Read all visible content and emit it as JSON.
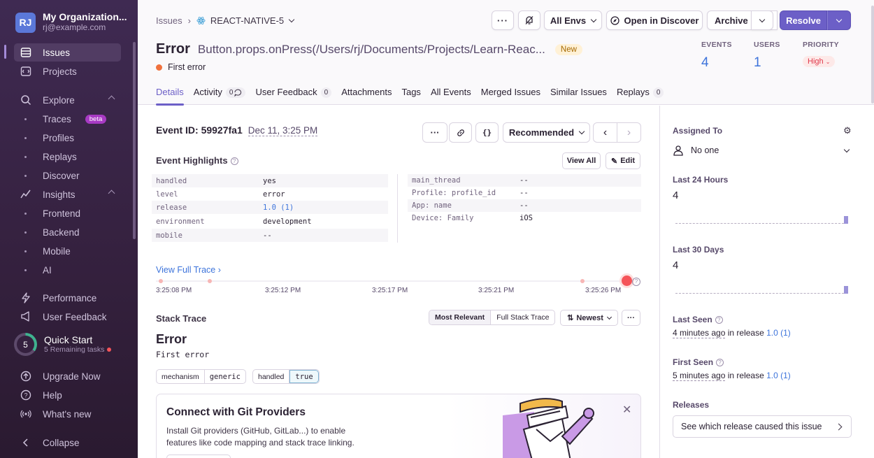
{
  "sidebar": {
    "org_initials": "RJ",
    "org_name": "My Organization...",
    "org_email": "rj@example.com",
    "items": {
      "issues": "Issues",
      "projects": "Projects",
      "explore": "Explore",
      "traces": "Traces",
      "traces_badge": "beta",
      "profiles": "Profiles",
      "replays": "Replays",
      "discover": "Discover",
      "insights": "Insights",
      "frontend": "Frontend",
      "backend": "Backend",
      "mobile": "Mobile",
      "ai": "AI",
      "performance": "Performance",
      "user_feedback": "User Feedback",
      "upgrade": "Upgrade Now",
      "help": "Help",
      "whats_new": "What's new",
      "collapse": "Collapse"
    },
    "quick_start": {
      "count": "5",
      "title": "Quick Start",
      "subtitle": "5 Remaining tasks"
    }
  },
  "header": {
    "breadcrumb_root": "Issues",
    "breadcrumb_project": "REACT-NATIVE-5",
    "env_label": "All Envs",
    "open_discover": "Open in Discover",
    "archive": "Archive",
    "resolve": "Resolve",
    "title": "Error",
    "subtitle": "Button.props.onPress(/Users/rj/Documents/Projects/Learn-Reac...",
    "badge": "New",
    "first_error": "First error",
    "stats": {
      "events_label": "EVENTS",
      "events": "4",
      "users_label": "USERS",
      "users": "1",
      "priority_label": "PRIORITY",
      "priority": "High"
    },
    "tabs": [
      {
        "label": "Details"
      },
      {
        "label": "Activity",
        "count": "0"
      },
      {
        "label": "User Feedback",
        "count": "0"
      },
      {
        "label": "Attachments"
      },
      {
        "label": "Tags"
      },
      {
        "label": "All Events"
      },
      {
        "label": "Merged Issues"
      },
      {
        "label": "Similar Issues"
      },
      {
        "label": "Replays",
        "count": "0"
      }
    ]
  },
  "event": {
    "id_label": "Event ID:",
    "id": "59927fa1",
    "date": "Dec 11, 3:25 PM",
    "sort": "Recommended",
    "json_icon": "{}",
    "highlights_title": "Event Highlights",
    "view_all": "View All",
    "edit": "Edit",
    "highlights_left": [
      {
        "k": "handled",
        "v": "yes"
      },
      {
        "k": "level",
        "v": "error"
      },
      {
        "k": "release",
        "v": "1.0 (1)"
      },
      {
        "k": "environment",
        "v": "development"
      },
      {
        "k": "mobile",
        "v": "--"
      }
    ],
    "highlights_right": [
      {
        "k": "main_thread",
        "v": "--"
      },
      {
        "k": "Profile: profile_id",
        "v": "--"
      },
      {
        "k": "App: name",
        "v": "--"
      },
      {
        "k": "Device: Family",
        "v": "iOS"
      }
    ],
    "view_trace": "View Full Trace",
    "timeline_labels": [
      "3:25:08 PM",
      "3:25:12 PM",
      "3:25:17 PM",
      "3:25:21 PM",
      "3:25:26 PM"
    ],
    "stack_title": "Stack Trace",
    "most_relevant": "Most Relevant",
    "full_stack": "Full Stack Trace",
    "newest": "Newest",
    "error_title": "Error",
    "error_message": "First error",
    "tags": [
      {
        "k": "mechanism",
        "v": "generic"
      },
      {
        "k": "handled",
        "v": "true"
      }
    ],
    "git": {
      "title": "Connect with Git Providers",
      "desc": "Install Git providers (GitHub, GitLab...) to enable features like code mapping and stack trace linking."
    }
  },
  "side": {
    "assigned_label": "Assigned To",
    "assigned_value": "No one",
    "last24_label": "Last 24 Hours",
    "last24_value": "4",
    "last30_label": "Last 30 Days",
    "last30_value": "4",
    "last_seen_label": "Last Seen",
    "last_seen_time": "4 minutes ago",
    "last_seen_release_prefix": "in release",
    "last_seen_release": "1.0 (1)",
    "first_seen_label": "First Seen",
    "first_seen_time": "5 minutes ago",
    "first_seen_release_prefix": "in release",
    "first_seen_release": "1.0 (1)",
    "releases_label": "Releases",
    "releases_button": "See which release caused this issue"
  },
  "colors": {
    "accent": "#6c5fc7",
    "link": "#3d74db",
    "sidebar": "#3f2a52",
    "error": "#f55459"
  }
}
